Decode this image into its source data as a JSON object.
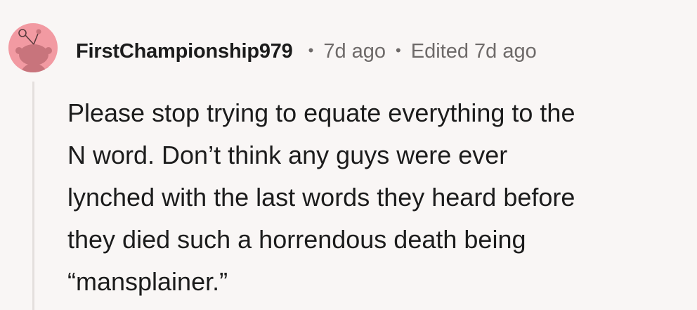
{
  "comment": {
    "username": "FirstChampionship979",
    "separator": "•",
    "age": "7d ago",
    "edited": "Edited 7d ago",
    "body": "Please stop trying to equate everything to the\nN word. Don’t think any guys were ever\nlynched with the last words they heard before\nthey died such a horrendous death being\n“mansplainer.”"
  },
  "colors": {
    "background": "#f9f6f5",
    "avatar_circle": "#f29aa2",
    "avatar_figure": "#c8747c",
    "username": "#1c1c1c",
    "meta": "#6e6a69",
    "thread_line": "#e4dfdd"
  },
  "icons": {
    "avatar": "snoo-avatar-icon"
  }
}
